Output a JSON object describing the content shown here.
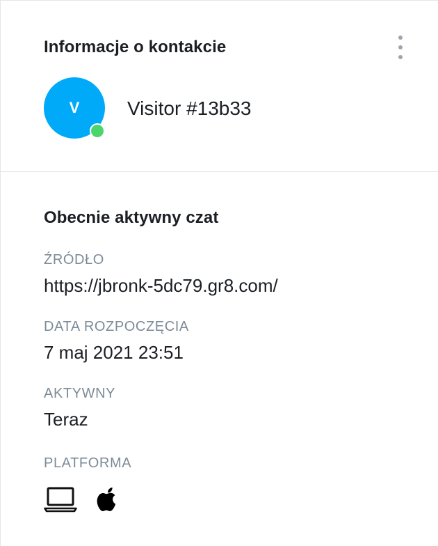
{
  "contact": {
    "title": "Informacje o kontakcie",
    "avatar_initial": "V",
    "visitor_name": "Visitor #13b33",
    "status": "online",
    "colors": {
      "avatar_bg": "#00aaf9",
      "status_dot": "#4cd46d"
    },
    "icons": {
      "more": "more-vertical-icon"
    }
  },
  "active_chat": {
    "title": "Obecnie aktywny czat",
    "fields": [
      {
        "label": "ŹRÓDŁO",
        "value": "https://jbronk-5dc79.gr8.com/"
      },
      {
        "label": "DATA ROZPOCZĘCIA",
        "value": "7 maj 2021 23:51"
      },
      {
        "label": "AKTYWNY",
        "value": "Teraz"
      }
    ],
    "platform": {
      "label": "PLATFORMA",
      "icons": [
        "laptop-icon",
        "apple-icon"
      ]
    }
  }
}
